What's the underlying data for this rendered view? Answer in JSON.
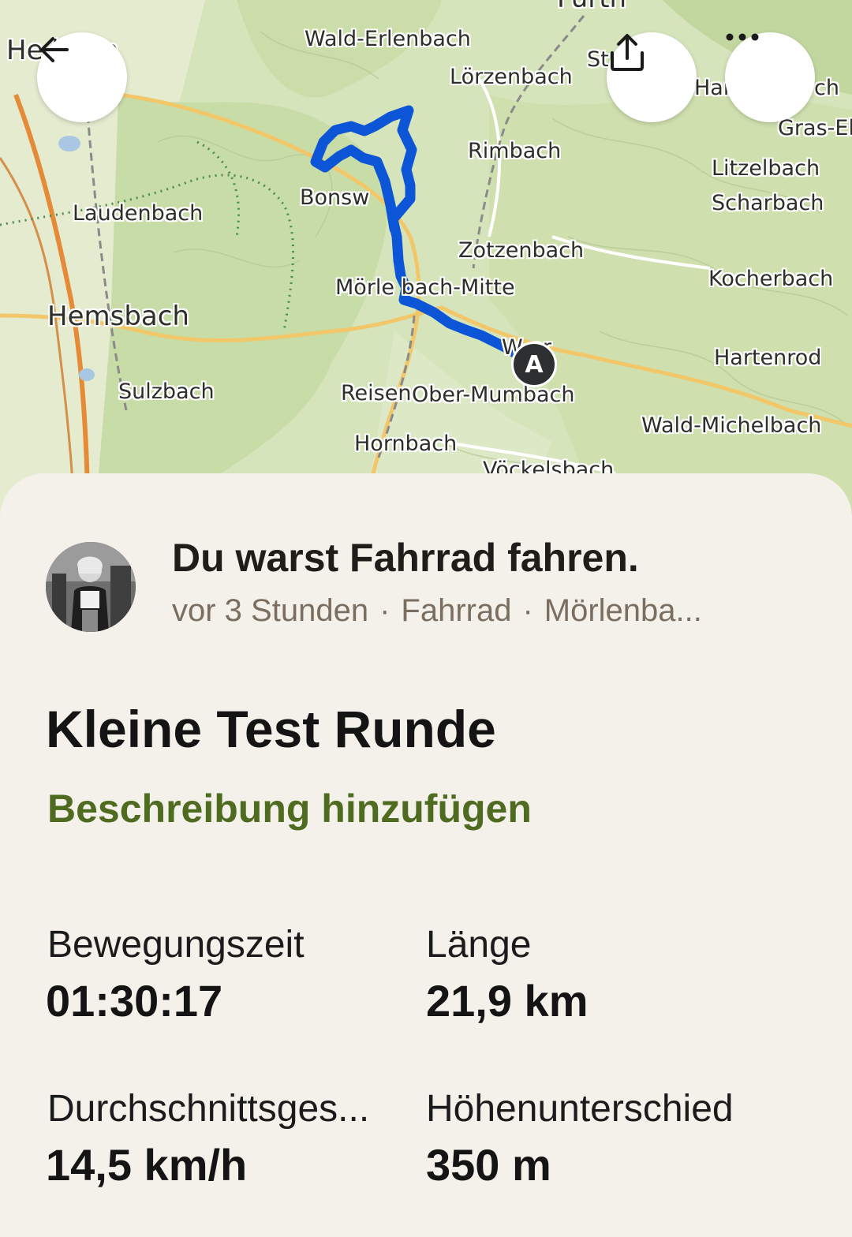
{
  "map": {
    "places": [
      {
        "key": "hemsbach_top",
        "text": "He    heim"
      },
      {
        "key": "wald_erlenbach",
        "text": "Wald-Erlenbach"
      },
      {
        "key": "lorzenbach",
        "text": "Lörzenbach"
      },
      {
        "key": "st",
        "text": "St"
      },
      {
        "key": "har",
        "text": "Har"
      },
      {
        "key": "ch",
        "text": "ch"
      },
      {
        "key": "gras_el",
        "text": "Gras-El"
      },
      {
        "key": "rimbach",
        "text": "Rimbach"
      },
      {
        "key": "litzelbach",
        "text": "Litzelbach"
      },
      {
        "key": "scharbach",
        "text": "Scharbach"
      },
      {
        "key": "laudenbach",
        "text": "Laudenbach"
      },
      {
        "key": "bonsweiher",
        "text": "Bonsw"
      },
      {
        "key": "zotzenbach",
        "text": "Zotzenbach"
      },
      {
        "key": "kocherbach",
        "text": "Kocherbach"
      },
      {
        "key": "morlenbach",
        "text": "Mörle   bach-Mitte"
      },
      {
        "key": "hemsbach",
        "text": "Hemsbach"
      },
      {
        "key": "weiher",
        "text": "W   er"
      },
      {
        "key": "hartenrod",
        "text": "Hartenrod"
      },
      {
        "key": "sulzbach",
        "text": "Sulzbach"
      },
      {
        "key": "reisen",
        "text": "Reisen"
      },
      {
        "key": "ober_mumbach",
        "text": "Ober-Mumbach"
      },
      {
        "key": "wald_michelbach",
        "text": "Wald-Michelbach"
      },
      {
        "key": "hornbach",
        "text": "Hornbach"
      },
      {
        "key": "vockelsbach",
        "text": "Vöckelsbach"
      },
      {
        "key": "furth",
        "text": "Fürth"
      }
    ],
    "start_marker": "A",
    "route_color": "#0c55d6"
  },
  "buttons": {
    "back_icon": "arrow-left-icon",
    "share_icon": "share-icon",
    "more_icon": "more-dots-icon"
  },
  "activity": {
    "headline": "Du warst Fahrrad fahren.",
    "time_ago": "vor 3 Stunden",
    "sport": "Fahrrad",
    "location": "Mörlenba...",
    "title": "Kleine Test Runde",
    "add_description": "Beschreibung hinzufügen"
  },
  "stats": {
    "moving_time_label": "Bewegungszeit",
    "moving_time_value": "01:30:17",
    "distance_label": "Länge",
    "distance_value": "21,9 km",
    "avg_speed_label": "Durchschnittsges...",
    "avg_speed_value": "14,5 km/h",
    "elevation_label": "Höhenunterschied",
    "elevation_value": "350 m"
  }
}
